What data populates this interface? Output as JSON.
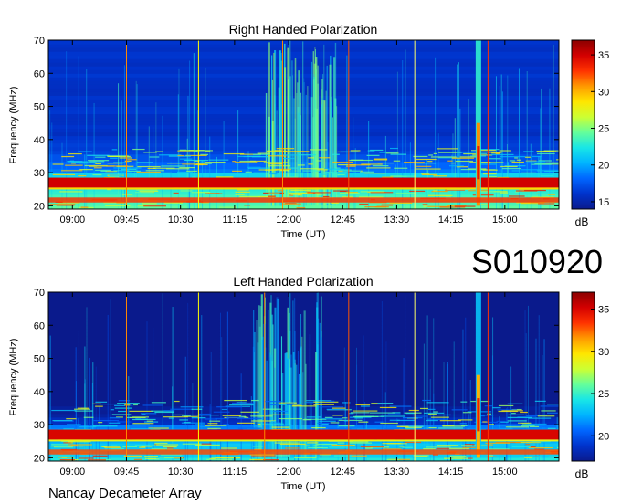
{
  "page": {
    "label": "S010920",
    "footer": "Nancay Decameter Array"
  },
  "colorscale": {
    "stops": [
      "#0a1a8c",
      "#0033cc",
      "#0066ff",
      "#00b4ff",
      "#19e6e6",
      "#66ff99",
      "#ccff33",
      "#ffe600",
      "#ff9900",
      "#ff3300",
      "#d40000",
      "#8b0000"
    ],
    "unit": "dB"
  },
  "chart_data": [
    {
      "type": "heatmap",
      "title": "Right Handed Polarization",
      "xlabel": "Time (UT)",
      "ylabel": "Frequency (MHz)",
      "xlim": [
        "08:40",
        "15:45"
      ],
      "ylim": [
        19,
        70
      ],
      "xticks": [
        "09:00",
        "09:45",
        "10:30",
        "11:15",
        "12:00",
        "12:45",
        "13:30",
        "14:15",
        "15:00"
      ],
      "yticks": [
        20,
        30,
        40,
        50,
        60,
        70
      ],
      "colorbar": {
        "ticks": [
          15,
          20,
          25,
          30,
          35
        ],
        "range": [
          14,
          37
        ],
        "unit": "dB"
      },
      "vertical_lines": [
        {
          "time": "09:45",
          "color": "#ff8800"
        },
        {
          "time": "10:45",
          "color": "#ffff00"
        },
        {
          "time": "11:55",
          "color": "#ff8800"
        },
        {
          "time": "12:50",
          "color": "#ff5500"
        },
        {
          "time": "13:45",
          "color": "#ffff66"
        },
        {
          "time": "14:46",
          "color": "#ff3300"
        }
      ],
      "features": [
        {
          "label": "strong band",
          "freq_range": [
            25.5,
            28.5
          ],
          "level_db": 35
        },
        {
          "label": "burst",
          "time": "14:38",
          "freq_range": [
            20,
            70
          ],
          "peak_db": 34
        },
        {
          "label": "emission cluster",
          "time_range": [
            "11:40",
            "12:40"
          ],
          "freq_range": [
            20,
            70
          ],
          "level_db": 24
        }
      ]
    },
    {
      "type": "heatmap",
      "title": "Left Handed Polarization",
      "xlabel": "Time (UT)",
      "ylabel": "Frequency (MHz)",
      "xlim": [
        "08:40",
        "15:45"
      ],
      "ylim": [
        19,
        70
      ],
      "xticks": [
        "09:00",
        "09:45",
        "10:30",
        "11:15",
        "12:00",
        "12:45",
        "13:30",
        "14:15",
        "15:00"
      ],
      "yticks": [
        20,
        30,
        40,
        50,
        60,
        70
      ],
      "colorbar": {
        "ticks": [
          20,
          25,
          30,
          35
        ],
        "range": [
          17,
          37
        ],
        "unit": "dB"
      },
      "vertical_lines": [
        {
          "time": "09:45",
          "color": "#ff8800"
        },
        {
          "time": "10:45",
          "color": "#ffff00"
        },
        {
          "time": "11:40",
          "color": "#ff8800"
        },
        {
          "time": "12:50",
          "color": "#ff5500"
        },
        {
          "time": "13:45",
          "color": "#ffff66"
        },
        {
          "time": "14:46",
          "color": "#ff3300"
        }
      ],
      "features": [
        {
          "label": "strong band",
          "freq_range": [
            25.5,
            28.5
          ],
          "level_db": 35
        },
        {
          "label": "burst",
          "time": "14:38",
          "freq_range": [
            20,
            70
          ],
          "peak_db": 34
        },
        {
          "label": "emission cluster",
          "time_range": [
            "11:30",
            "12:30"
          ],
          "freq_range": [
            20,
            70
          ],
          "level_db": 24
        }
      ]
    }
  ]
}
